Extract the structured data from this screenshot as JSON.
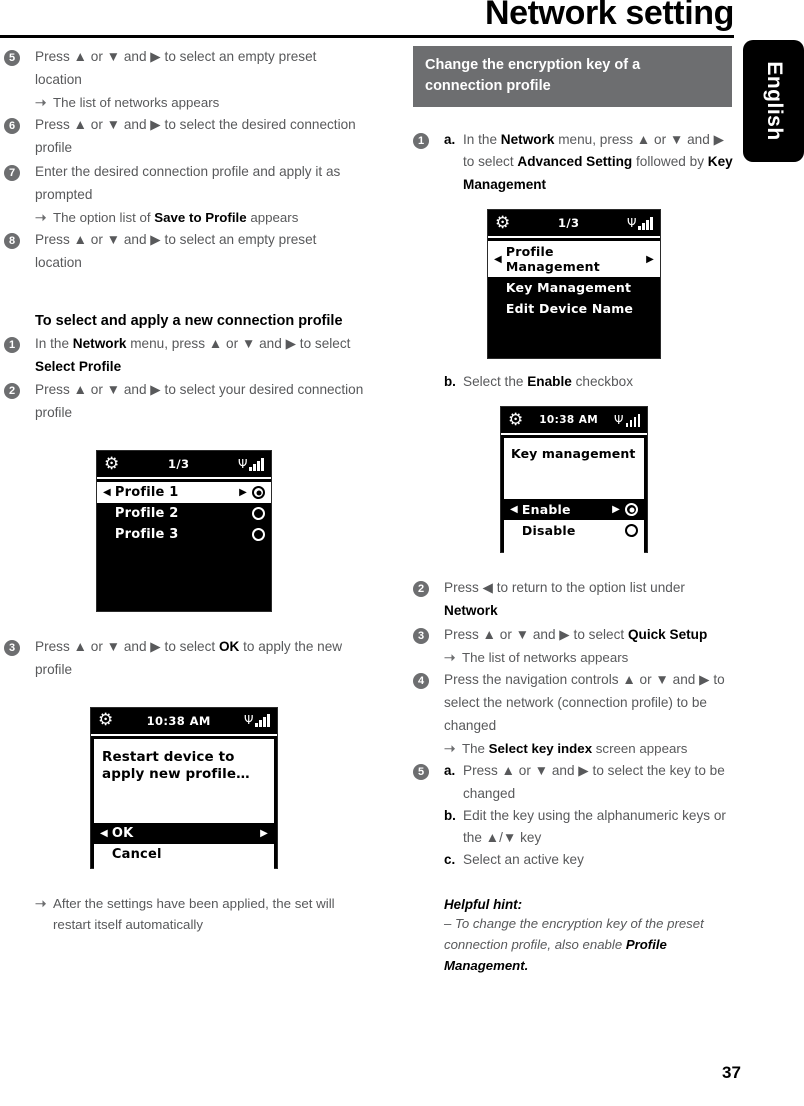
{
  "page": {
    "title": "Network setting",
    "language_tab": "English",
    "number": "37"
  },
  "left_column": {
    "steps": [
      {
        "badge": "5",
        "text_parts": [
          "Press ",
          "▲",
          " or ",
          "▼",
          " and ",
          "▶",
          " to select an empty preset location"
        ],
        "text": "Press ▲ or ▼ and ▶ to select an empty preset location",
        "result": "The list of networks appears"
      },
      {
        "badge": "6",
        "text": "Press ▲ or ▼ and ▶ to select the desired connection profile"
      },
      {
        "badge": "7",
        "text": "Enter the desired connection profile and apply it as prompted",
        "result_prefix": "The option list of ",
        "result_bold": "Save to Profile",
        "result_suffix": " appears"
      },
      {
        "badge": "8",
        "text": "Press ▲ or ▼ and ▶ to select an empty preset location"
      }
    ],
    "subheading": "To select and apply a new connection profile",
    "steps2": [
      {
        "badge": "1",
        "p1": "In the ",
        "b1": "Network",
        "p2": " menu, press ▲ or ▼ and ▶ to select ",
        "b2": "Select Profile",
        "p3": ""
      },
      {
        "badge": "2",
        "p1": "Press ▲ or ▼ and ▶ to select your desired connection profile",
        "b1": "",
        "p2": "",
        "b2": "",
        "p3": ""
      }
    ],
    "screen_profile": {
      "gear": "gear-icon",
      "status_center": "1/3",
      "rows": [
        {
          "label": "Profile 1",
          "selected": true,
          "radio": "on",
          "carets": true
        },
        {
          "label": "Profile 2",
          "selected": false,
          "radio": "off",
          "carets": false
        },
        {
          "label": "Profile 3",
          "selected": false,
          "radio": "off",
          "carets": false
        }
      ]
    },
    "step3": {
      "badge": "3",
      "p1": "Press ▲ or ▼ and ▶ to select ",
      "b1": "OK",
      "p2": " to apply the new profile"
    },
    "screen_restart": {
      "status_center": "10:38 AM",
      "message": "Restart device to apply new profile…",
      "rows": [
        {
          "label": "OK",
          "selected": true,
          "carets": true
        },
        {
          "label": "Cancel",
          "selected": false,
          "carets": false
        }
      ]
    },
    "final_result": "After the settings have been applied, the set will restart itself automatically"
  },
  "right_column": {
    "section_header": "Change the encryption key of a connection profile",
    "step1": {
      "badge": "1",
      "letter_a": "a.",
      "a_p1": "In the ",
      "a_b1": "Network",
      "a_p2": " menu, press ▲ or ▼ and ▶ to select ",
      "a_b2": "Advanced Setting",
      "a_p3": " followed by ",
      "a_b3": "Key Management",
      "letter_b": "b.",
      "b_p1": "Select the ",
      "b_b1": "Enable",
      "b_p2": " checkbox"
    },
    "screen_advanced": {
      "status_center": "1/3",
      "rows": [
        {
          "label": "Profile Management",
          "selected": true,
          "carets": true
        },
        {
          "label": "Key Management",
          "selected": false,
          "carets": false
        },
        {
          "label": "Edit Device Name",
          "selected": false,
          "carets": false
        }
      ]
    },
    "screen_keymgmt": {
      "status_center": "10:38 AM",
      "title": "Key management",
      "rows": [
        {
          "label": "Enable",
          "selected": true,
          "radio": "on",
          "carets": true
        },
        {
          "label": "Disable",
          "selected": false,
          "radio": "off",
          "carets": false
        }
      ]
    },
    "steps": [
      {
        "badge": "2",
        "p1": "Press ◀ to return to the option list under ",
        "b1": "Network",
        "p2": ""
      },
      {
        "badge": "3",
        "p1": "Press ▲ or ▼ and ▶ to select ",
        "b1": "Quick Setup",
        "p2": "",
        "result": "The list of networks appears"
      },
      {
        "badge": "4",
        "p1": "Press the navigation controls ▲ or ▼ and ▶ to select the network (connection profile) to be changed",
        "b1": "",
        "p2": "",
        "result_prefix": "The ",
        "result_bold": "Select key index",
        "result_suffix": " screen appears"
      }
    ],
    "step5": {
      "badge": "5",
      "a_letter": "a.",
      "a_text": "Press ▲ or ▼ and ▶ to select the key to be changed",
      "b_letter": "b.",
      "b_text": "Edit the key using the alphanumeric keys or the ▲/▼ key",
      "c_letter": "c.",
      "c_text": "Select an active key"
    },
    "hint": {
      "title": "Helpful hint:",
      "p1": "– To change the encryption key of the preset connection profile, also enable ",
      "b1": "Profile Management.",
      "p2": ""
    }
  }
}
